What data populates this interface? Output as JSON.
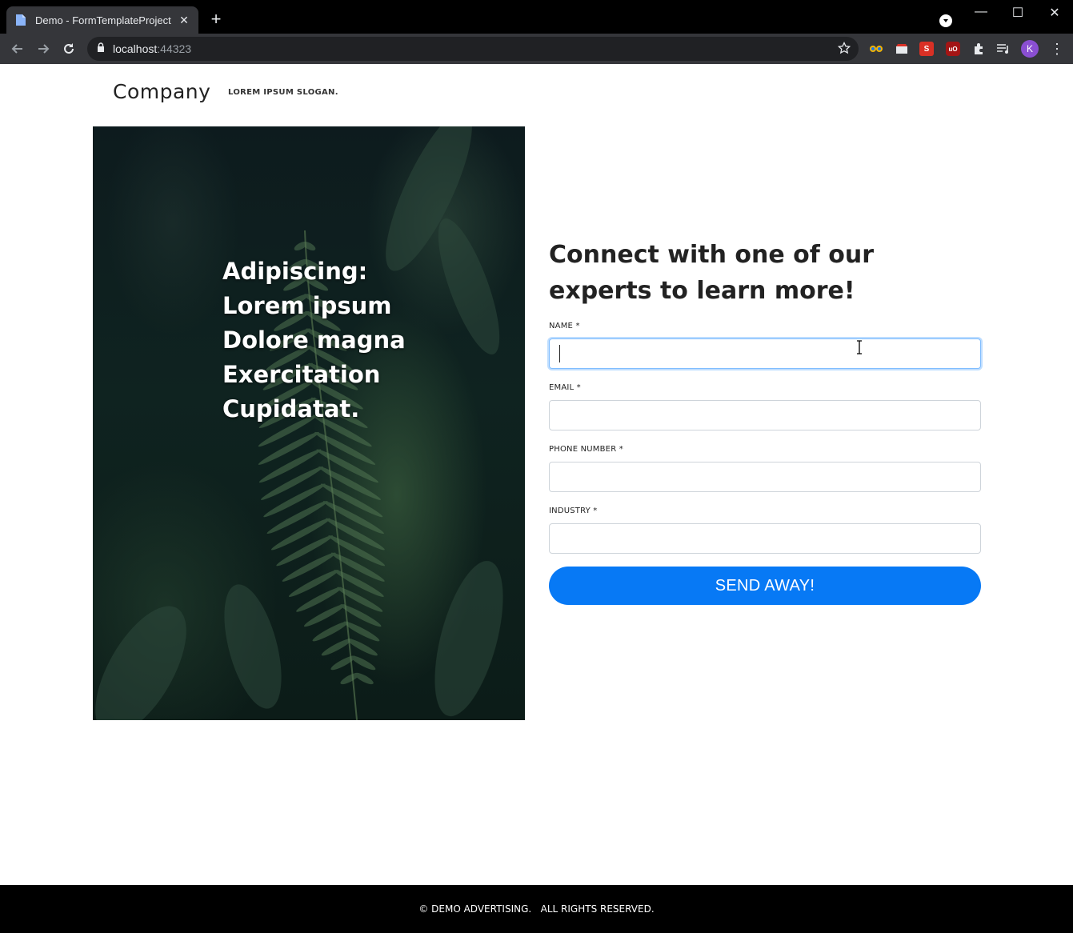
{
  "browser": {
    "tab_title": "Demo - FormTemplateProject",
    "tab_close_glyph": "✕",
    "new_tab_glyph": "+",
    "url_host": "localhost",
    "url_port": ":44323",
    "avatar_letter": "K",
    "window_controls": {
      "minimize": "—",
      "maximize": "☐",
      "close": "✕"
    },
    "extensions": [
      {
        "name": "eyes-extension-icon",
        "color": "#4a6aa0"
      },
      {
        "name": "store-extension-icon",
        "color": "#5f6368"
      },
      {
        "name": "s-extension-icon",
        "color": "#d93025",
        "label": "S"
      },
      {
        "name": "ublock-extension-icon",
        "color": "#a31515",
        "label": "uO"
      },
      {
        "name": "puzzle-extension-icon",
        "color": "#5f6368"
      },
      {
        "name": "media-queue-icon",
        "color": "#5f6368"
      }
    ]
  },
  "header": {
    "brand": "Company",
    "slogan": "LOREM IPSUM SLOGAN."
  },
  "hero": {
    "lines": [
      "Adipiscing:",
      "Lorem ipsum",
      "Dolore magna",
      "Exercitation",
      "Cupidatat."
    ]
  },
  "form": {
    "heading": "Connect with one of our experts to learn more!",
    "fields": [
      {
        "label": "NAME *",
        "value": "",
        "focused": true
      },
      {
        "label": "EMAIL *",
        "value": ""
      },
      {
        "label": "PHONE NUMBER *",
        "value": ""
      },
      {
        "label": "INDUSTRY *",
        "value": ""
      }
    ],
    "submit_label": "SEND AWAY!",
    "accent_color": "#0779f5"
  },
  "footer": {
    "copyright": "© DEMO ADVERTISING.   ALL RIGHTS RESERVED."
  }
}
